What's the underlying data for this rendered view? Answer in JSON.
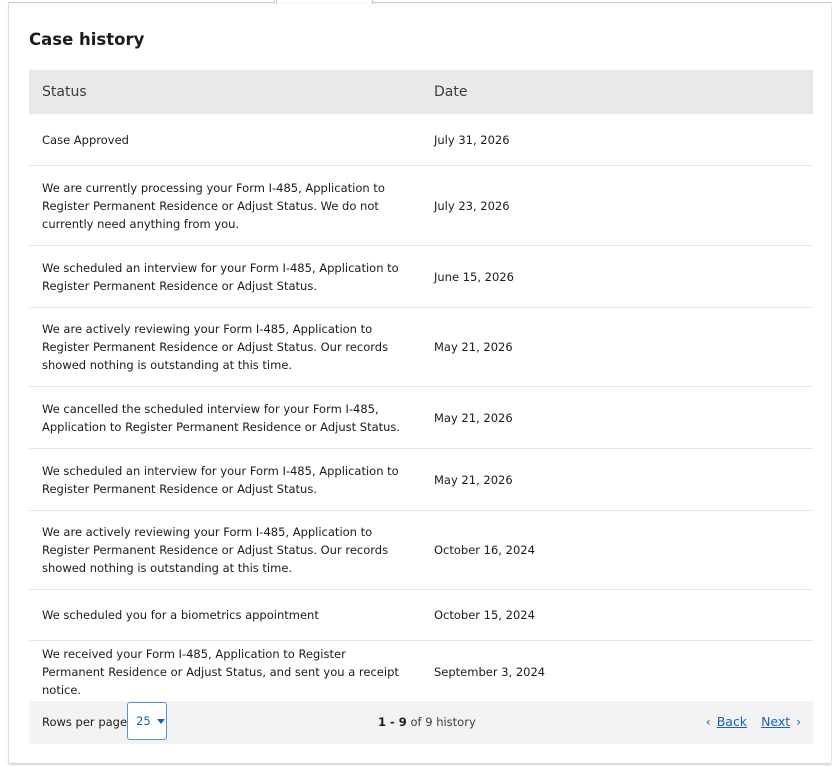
{
  "section": {
    "title": "Case history"
  },
  "table": {
    "headers": {
      "status": "Status",
      "date": "Date"
    },
    "rows": [
      {
        "status": "Case Approved",
        "date": "July 31, 2026"
      },
      {
        "status": "We are currently processing your Form I-485, Application to Register Permanent Residence or Adjust Status.  We do not currently need anything from you.",
        "date": "July 23, 2026"
      },
      {
        "status": "We scheduled an interview for your Form I-485, Application to Register Permanent Residence or Adjust Status.",
        "date": "June 15, 2026"
      },
      {
        "status": "We are actively reviewing your Form I-485, Application to Register Permanent Residence or Adjust Status. Our records showed nothing is outstanding at this time.",
        "date": "May 21, 2026"
      },
      {
        "status": "We cancelled the scheduled interview for your Form I-485, Application to Register Permanent Residence or Adjust Status.",
        "date": "May 21, 2026"
      },
      {
        "status": "We scheduled an interview for your Form I-485, Application to Register Permanent Residence or Adjust Status.",
        "date": "May 21, 2026"
      },
      {
        "status": "We are actively reviewing your Form I-485, Application to Register Permanent Residence or Adjust Status. Our records showed nothing is outstanding at this time.",
        "date": "October 16, 2024"
      },
      {
        "status": "We scheduled you for a biometrics appointment",
        "date": "October 15, 2024"
      },
      {
        "status": "We received your Form I-485, Application to Register Permanent Residence or Adjust Status, and sent you a receipt notice.",
        "date": "September 3, 2024"
      }
    ]
  },
  "pagination": {
    "rows_per_page_label": "Rows per page:",
    "rows_per_page_value": "25",
    "range_start": "1",
    "range_sep": " - ",
    "range_end": "9",
    "of_text": " of ",
    "total": "9",
    "unit": " history",
    "back_label": "Back",
    "next_label": "Next",
    "back_icon": "chevron-left-icon",
    "next_icon": "chevron-right-icon"
  },
  "colors": {
    "header_bg": "#e9e9e9",
    "footer_bg": "#f3f3f3",
    "link": "#1b62b3",
    "text": "#1b1b1b"
  }
}
